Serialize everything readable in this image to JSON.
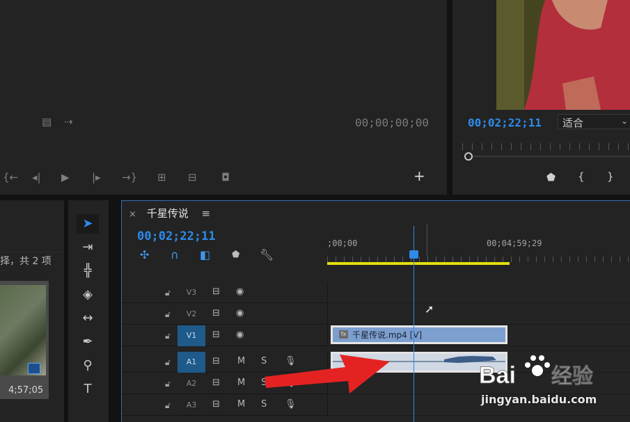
{
  "source_monitor": {
    "timecode": "00;00;00;00",
    "controls": [
      "mark-in-icon",
      "step-back-icon",
      "play-icon",
      "step-forward-icon",
      "go-to-out-icon",
      "insert-icon",
      "overwrite-icon",
      "camera-icon",
      "add-button-icon"
    ]
  },
  "program_monitor": {
    "timecode": "00;02;22;11",
    "fit_select": "适合"
  },
  "project_panel": {
    "item_count_text": "择，共 2 项",
    "thumb_duration": "4;57;05"
  },
  "timeline": {
    "tab_title": "千星传说",
    "timecode": "00;02;22;11",
    "ruler_start": ";00;00",
    "ruler_mid": "00;04;59;29",
    "tracks": [
      {
        "name": "V3",
        "type": "video"
      },
      {
        "name": "V2",
        "type": "video"
      },
      {
        "name": "V1",
        "type": "video",
        "on": true
      },
      {
        "name": "A1",
        "type": "audio",
        "on": true,
        "m": "M",
        "s": "S"
      },
      {
        "name": "A2",
        "type": "audio",
        "m": "M",
        "s": "S"
      },
      {
        "name": "A3",
        "type": "audio",
        "m": "M",
        "s": "S"
      }
    ],
    "video_clip_label": "千星传说.mp4 [V]"
  },
  "watermark": {
    "url": "jingyan.baidu.com",
    "logo_text": "Bai经验"
  },
  "colors": {
    "accent_blue": "#2d8ceb",
    "work_area_yellow": "#e1df0d",
    "arrow_red": "#e52222"
  }
}
